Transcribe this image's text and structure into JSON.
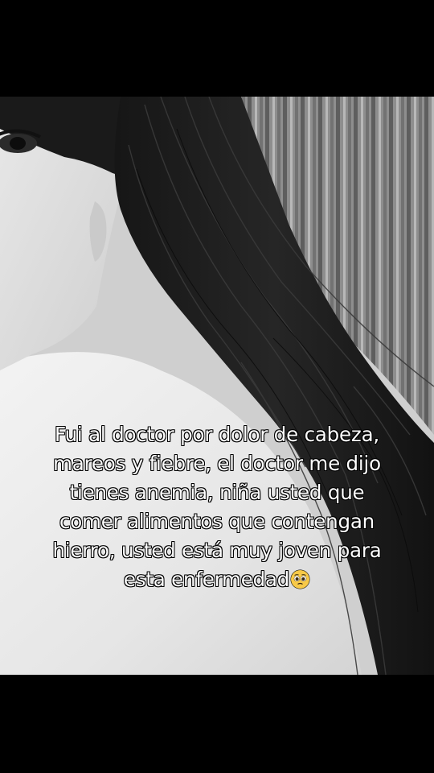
{
  "overlay_text": {
    "lines": [
      "Fui al doctor por dolor de cabeza,",
      "mareos y fiebre, el doctor me dijo",
      "tienes anemia, niña usted que",
      "comer alimentos que contengan",
      "hierro, usted está muy joven para",
      "esta enfermedad"
    ],
    "emoji": "pleading-face"
  },
  "photo": {
    "style": "black-and-white selfie",
    "subjects": [
      "face",
      "eye",
      "long dark hair",
      "white top",
      "striped curtain"
    ]
  }
}
